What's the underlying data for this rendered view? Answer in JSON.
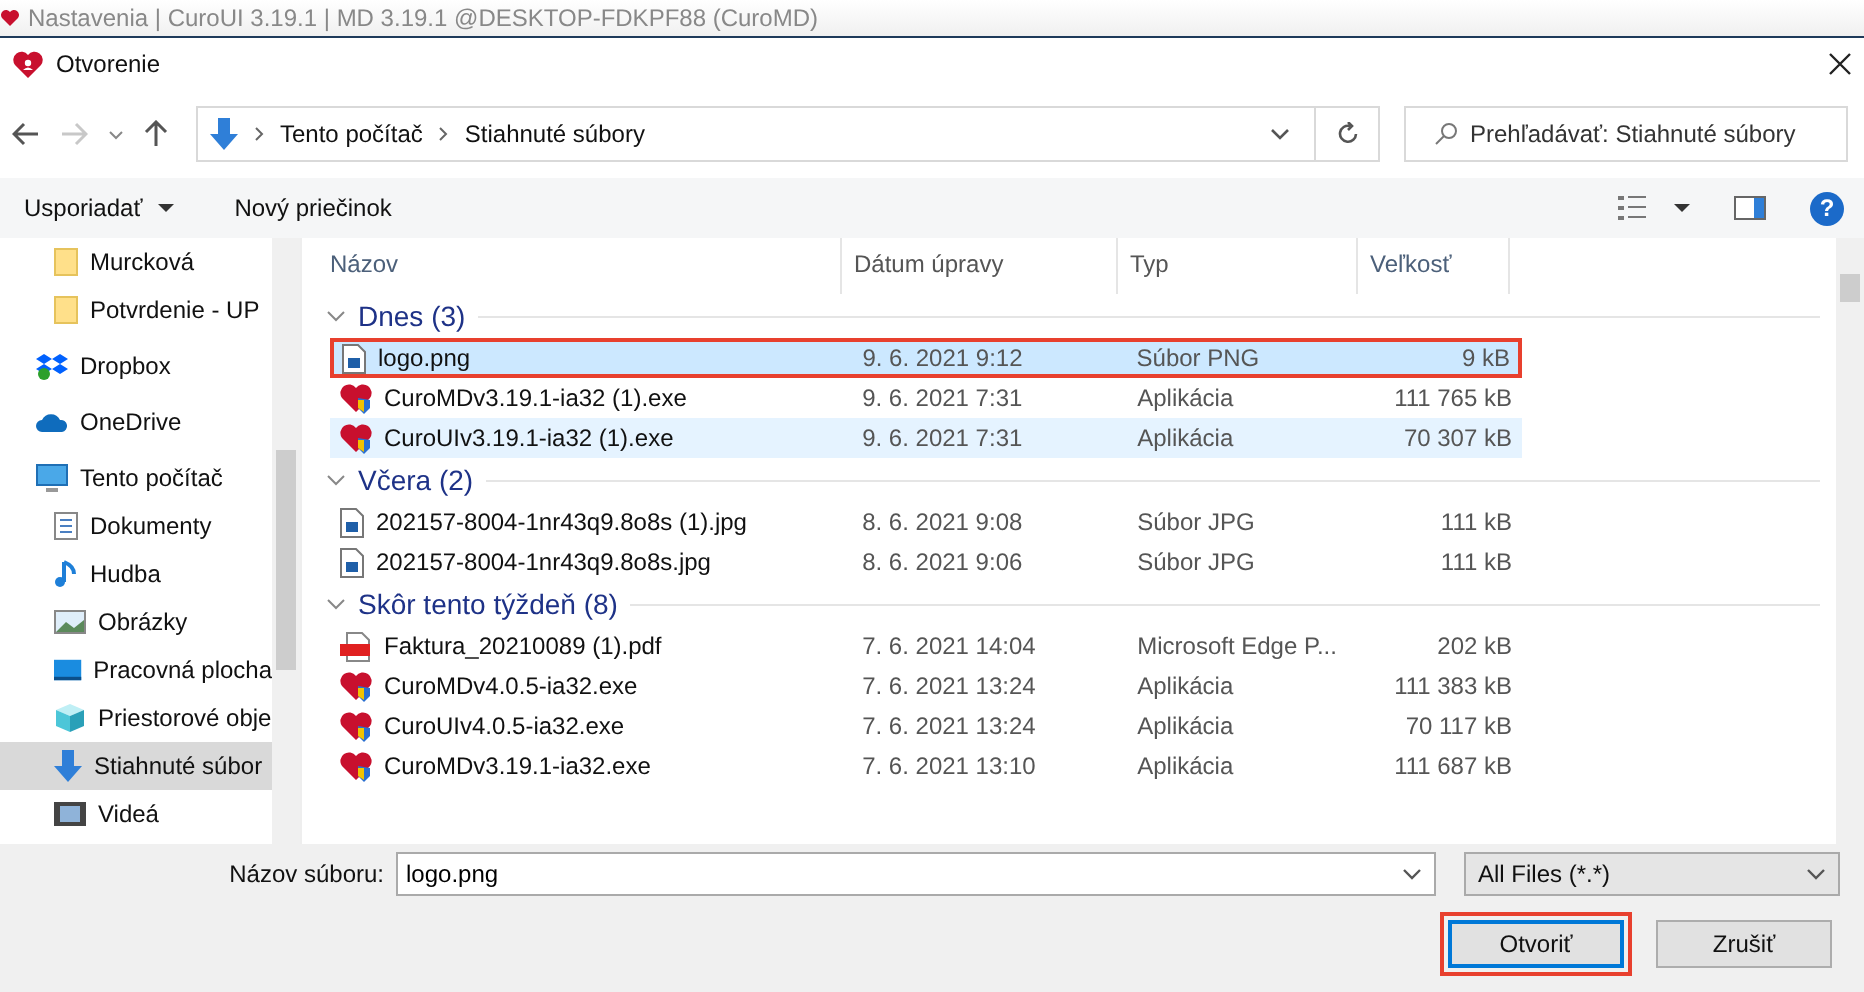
{
  "parent_window": {
    "title": "Nastavenia | CuroUI 3.19.1 | MD 3.19.1 @DESKTOP-FDKPF88 (CuroMD)"
  },
  "dialog": {
    "title": "Otvorenie"
  },
  "address_bar": {
    "path": [
      "Tento počítač",
      "Stiahnuté súbory"
    ]
  },
  "search": {
    "placeholder": "Prehľadávať: Stiahnuté súbory"
  },
  "toolbar": {
    "organize": "Usporiadať",
    "new_folder": "Nový priečinok",
    "help_glyph": "?"
  },
  "sidebar": {
    "items": [
      {
        "label": "Murcková",
        "kind": "pinned-folder",
        "selected": false
      },
      {
        "label": "Potvrdenie - UP",
        "kind": "pinned-folder",
        "selected": false
      },
      {
        "label": "Dropbox",
        "kind": "dropbox",
        "selected": false
      },
      {
        "label": "OneDrive",
        "kind": "onedrive",
        "selected": false
      },
      {
        "label": "Tento počítač",
        "kind": "computer",
        "selected": false,
        "children": [
          {
            "label": "Dokumenty",
            "kind": "documents",
            "selected": false
          },
          {
            "label": "Hudba",
            "kind": "music",
            "selected": false
          },
          {
            "label": "Obrázky",
            "kind": "pictures",
            "selected": false
          },
          {
            "label": "Pracovná plocha",
            "kind": "desktop",
            "selected": false
          },
          {
            "label": "Priestorové obje",
            "kind": "objects",
            "selected": false
          },
          {
            "label": "Stiahnuté súbor",
            "kind": "downloads",
            "selected": true
          },
          {
            "label": "Videá",
            "kind": "videos",
            "selected": false
          }
        ]
      }
    ]
  },
  "table": {
    "columns": [
      "Názov",
      "Dátum úpravy",
      "Typ",
      "Veľkosť"
    ],
    "groups": [
      {
        "name": "Dnes (3)",
        "expanded": true,
        "rows": [
          {
            "name": "logo.png",
            "date": "9. 6. 2021 9:12",
            "type": "Súbor PNG",
            "size": "9 kB",
            "kind": "image",
            "selected": true,
            "hovered": false,
            "highlighted": true
          },
          {
            "name": "CuroMDv3.19.1-ia32 (1).exe",
            "date": "9. 6. 2021 7:31",
            "type": "Aplikácia",
            "size": "111 765 kB",
            "kind": "app",
            "selected": false,
            "hovered": false,
            "highlighted": false
          },
          {
            "name": "CuroUIv3.19.1-ia32 (1).exe",
            "date": "9. 6. 2021 7:31",
            "type": "Aplikácia",
            "size": "70 307 kB",
            "kind": "app",
            "selected": false,
            "hovered": true,
            "highlighted": false
          }
        ]
      },
      {
        "name": "Včera (2)",
        "expanded": true,
        "rows": [
          {
            "name": "202157-8004-1nr43q9.8o8s (1).jpg",
            "date": "8. 6. 2021 9:08",
            "type": "Súbor JPG",
            "size": "111 kB",
            "kind": "image",
            "selected": false,
            "hovered": false,
            "highlighted": false
          },
          {
            "name": "202157-8004-1nr43q9.8o8s.jpg",
            "date": "8. 6. 2021 9:06",
            "type": "Súbor JPG",
            "size": "111 kB",
            "kind": "image",
            "selected": false,
            "hovered": false,
            "highlighted": false
          }
        ]
      },
      {
        "name": "Skôr tento týždeň (8)",
        "expanded": true,
        "rows": [
          {
            "name": "Faktura_20210089 (1).pdf",
            "date": "7. 6. 2021 14:04",
            "type": "Microsoft Edge P...",
            "size": "202 kB",
            "kind": "pdf",
            "selected": false,
            "hovered": false,
            "highlighted": false
          },
          {
            "name": "CuroMDv4.0.5-ia32.exe",
            "date": "7. 6. 2021 13:24",
            "type": "Aplikácia",
            "size": "111 383 kB",
            "kind": "app",
            "selected": false,
            "hovered": false,
            "highlighted": false
          },
          {
            "name": "CuroUIv4.0.5-ia32.exe",
            "date": "7. 6. 2021 13:24",
            "type": "Aplikácia",
            "size": "70 117 kB",
            "kind": "app",
            "selected": false,
            "hovered": false,
            "highlighted": false
          },
          {
            "name": "CuroMDv3.19.1-ia32.exe",
            "date": "7. 6. 2021 13:10",
            "type": "Aplikácia",
            "size": "111 687 kB",
            "kind": "app",
            "selected": false,
            "hovered": false,
            "highlighted": false
          }
        ]
      }
    ]
  },
  "footer": {
    "filename_label": "Názov súboru:",
    "filename_value": "logo.png",
    "filter": "All Files (*.*)",
    "buttons": [
      {
        "label": "Otvoriť",
        "default": true,
        "highlighted": true
      },
      {
        "label": "Zrušiť",
        "default": false,
        "highlighted": false
      }
    ]
  }
}
